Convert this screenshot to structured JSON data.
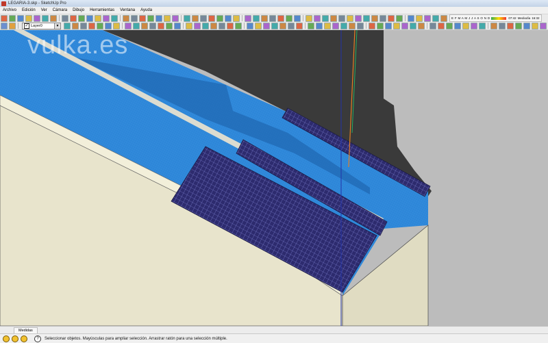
{
  "window": {
    "title": "LEGARIA-3.skp - SketchUp Pro"
  },
  "menu": [
    "Archivo",
    "Edición",
    "Ver",
    "Cámara",
    "Dibujo",
    "Herramientas",
    "Ventana",
    "Ayuda"
  ],
  "layer_toolbar": {
    "current_layer": "Layer0"
  },
  "shadow_toolbar": {
    "months": "E F M A M J J A S O N D",
    "time": "07:42",
    "midday": "Mediodía",
    "end_time": "16:32"
  },
  "watermark": "vulka.es",
  "tabs": [
    "Medidas"
  ],
  "status": {
    "text": "Seleccionar objetos. Mayúsculas para ampliar selección. Arrastrar ratón para una selección múltiple."
  },
  "colors": {
    "roof_blue": "#2d86d8",
    "roof_shadow": "#1f66b0",
    "panel": "#2d2b6e",
    "panel_grid": "#8a8ee0",
    "wall_cream": "#e8e4cc",
    "dark_surface": "#3a3a3a",
    "axis_blue": "#2233aa",
    "axis_orange": "#e67e22"
  }
}
